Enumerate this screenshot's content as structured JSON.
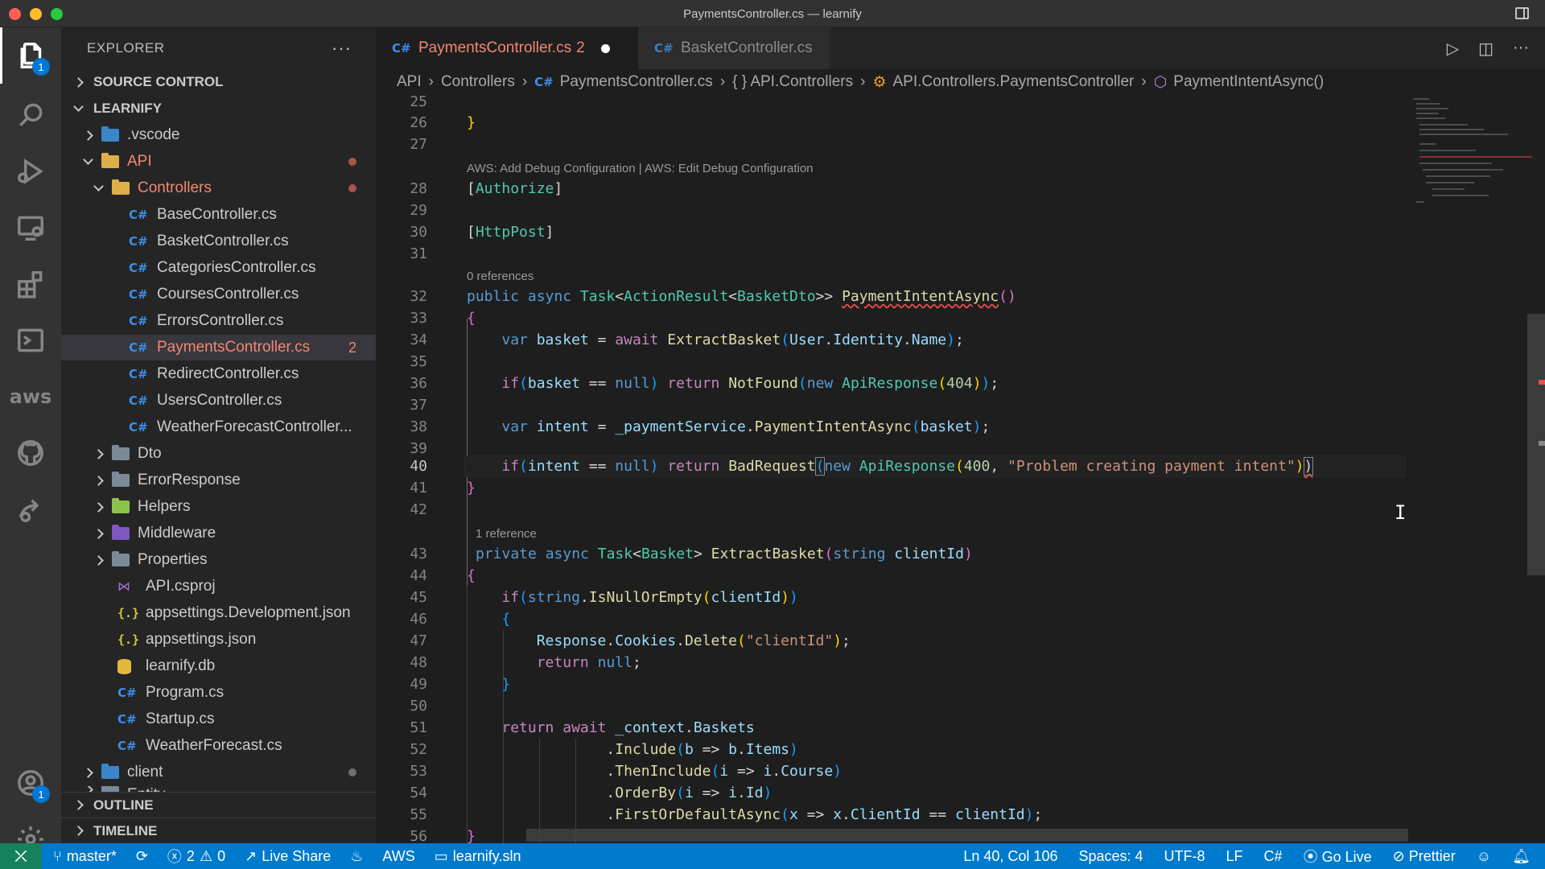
{
  "window": {
    "title": "PaymentsController.cs — learnify"
  },
  "activity_bar": {
    "items": [
      {
        "name": "explorer-icon",
        "badge": "1"
      },
      {
        "name": "search-icon"
      },
      {
        "name": "run-debug-icon"
      },
      {
        "name": "remote-explorer-icon"
      },
      {
        "name": "extensions-icon"
      },
      {
        "name": "terminal-icon"
      },
      {
        "name": "aws-icon",
        "label": "aws"
      },
      {
        "name": "github-icon"
      },
      {
        "name": "live-share-icon"
      }
    ],
    "accounts_badge": "1"
  },
  "sidebar": {
    "title": "EXPLORER",
    "more": "···",
    "source_control": "SOURCE CONTROL",
    "project": "LEARNIFY",
    "tree": [
      {
        "label": ".vscode",
        "type": "folder",
        "icon": "folder-vscode"
      },
      {
        "label": "API",
        "type": "folder-open",
        "icon": "folder-api",
        "modified": true
      },
      {
        "label": "Controllers",
        "type": "folder-open",
        "icon": "folder-controllers",
        "modified": true
      },
      {
        "label": "BaseController.cs",
        "type": "cs"
      },
      {
        "label": "BasketController.cs",
        "type": "cs"
      },
      {
        "label": "CategoriesController.cs",
        "type": "cs"
      },
      {
        "label": "CoursesController.cs",
        "type": "cs"
      },
      {
        "label": "ErrorsController.cs",
        "type": "cs"
      },
      {
        "label": "PaymentsController.cs",
        "type": "cs",
        "errors": "2"
      },
      {
        "label": "RedirectController.cs",
        "type": "cs"
      },
      {
        "label": "UsersController.cs",
        "type": "cs"
      },
      {
        "label": "WeatherForecastController...",
        "type": "cs"
      },
      {
        "label": "Dto",
        "type": "folder"
      },
      {
        "label": "ErrorResponse",
        "type": "folder"
      },
      {
        "label": "Helpers",
        "type": "folder"
      },
      {
        "label": "Middleware",
        "type": "folder"
      },
      {
        "label": "Properties",
        "type": "folder"
      },
      {
        "label": "API.csproj",
        "type": "csproj"
      },
      {
        "label": "appsettings.Development.json",
        "type": "json"
      },
      {
        "label": "appsettings.json",
        "type": "json"
      },
      {
        "label": "learnify.db",
        "type": "db"
      },
      {
        "label": "Program.cs",
        "type": "cs"
      },
      {
        "label": "Startup.cs",
        "type": "cs"
      },
      {
        "label": "WeatherForecast.cs",
        "type": "cs"
      },
      {
        "label": "client",
        "type": "folder"
      },
      {
        "label": "Entity",
        "type": "folder"
      }
    ],
    "outline": "OUTLINE",
    "timeline": "TIMELINE"
  },
  "tabs": [
    {
      "label": "PaymentsController.cs",
      "lang": "C#",
      "problems": "2",
      "dirty": true
    },
    {
      "label": "BasketController.cs",
      "lang": "C#"
    }
  ],
  "breadcrumbs": [
    "API",
    "Controllers",
    "PaymentsController.cs",
    "{ } API.Controllers",
    "API.Controllers.PaymentsController",
    "PaymentIntentAsync()"
  ],
  "editor": {
    "lenses": {
      "debug": "AWS: Add Debug Configuration | AWS: Edit Debug Configuration",
      "refs0": "0 references",
      "refs1": "1 reference"
    },
    "line_numbers": [
      "25",
      "26",
      "27",
      "28",
      "29",
      "30",
      "31",
      "32",
      "33",
      "34",
      "35",
      "36",
      "37",
      "38",
      "39",
      "40",
      "41",
      "42",
      "43",
      "44",
      "45",
      "46",
      "47",
      "48",
      "49",
      "50",
      "51",
      "52",
      "53",
      "54",
      "55",
      "56"
    ]
  },
  "statusbar": {
    "branch": "master*",
    "errors": "2",
    "warnings": "0",
    "live_share": "Live Share",
    "aws": "AWS",
    "solution": "learnify.sln",
    "position": "Ln 40, Col 106",
    "spaces": "Spaces: 4",
    "encoding": "UTF-8",
    "eol": "LF",
    "language": "C#",
    "go_live": "Go Live",
    "prettier": "Prettier"
  }
}
